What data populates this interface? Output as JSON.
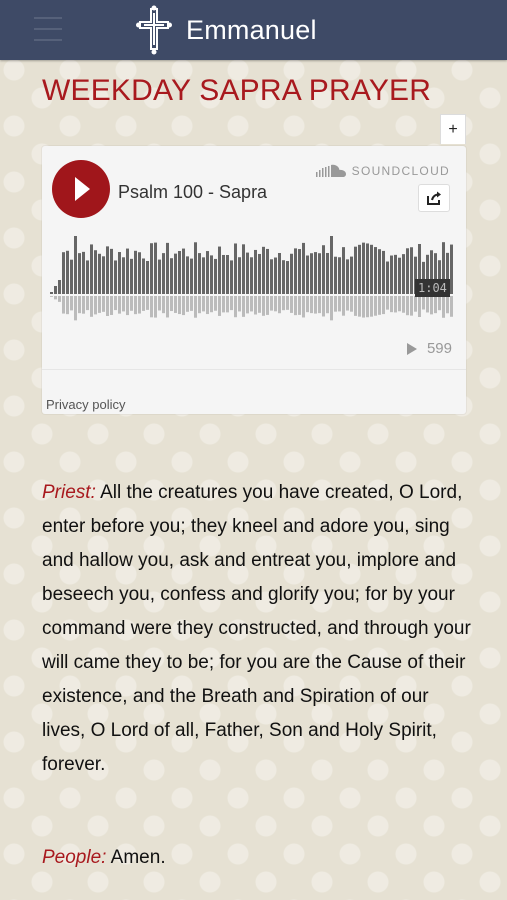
{
  "header": {
    "brand_name": "Emmanuel",
    "logo_icon": "cross-icon",
    "menu_icon": "hamburger-menu-icon",
    "colors": {
      "navbar": "#3e4a66",
      "title_red": "#a8191e"
    }
  },
  "page": {
    "title": "WEEKDAY SAPRA PRAYER"
  },
  "player": {
    "expand_label": "+",
    "track_title": "Psalm 100 - Sapra",
    "brand_label": "SOUNDCLOUD",
    "timecode": "1:04",
    "play_count": "599",
    "privacy_label": "Privacy policy",
    "play_color": "#a0161b",
    "progress": 0
  },
  "prayer": {
    "priest_label": "Priest:",
    "priest_text": " All the creatures you have created, O Lord, enter before you; they kneel and adore you, sing and hallow you, ask and entreat you, implore and beseech you, confess and glorify you; for by your command were they constructed, and through your will came they to be; for you are the Cause of their existence, and the Breath and Spiration of our lives, O Lord of all, Father, Son and Holy Spirit, forever.",
    "people_label": "People:",
    "people_text": " Amen."
  }
}
